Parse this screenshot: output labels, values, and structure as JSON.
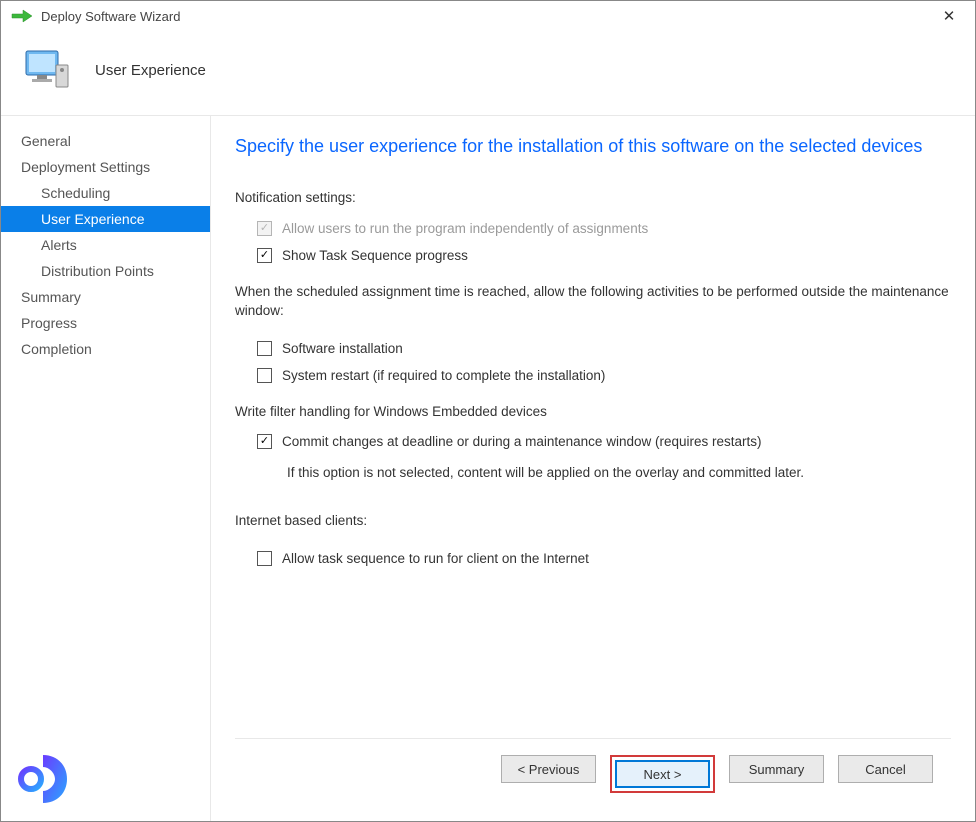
{
  "window": {
    "title": "Deploy Software Wizard"
  },
  "header": {
    "step": "User Experience"
  },
  "sidebar": {
    "items": [
      {
        "label": "General",
        "sub": false,
        "selected": false
      },
      {
        "label": "Deployment Settings",
        "sub": false,
        "selected": false
      },
      {
        "label": "Scheduling",
        "sub": true,
        "selected": false
      },
      {
        "label": "User Experience",
        "sub": true,
        "selected": true
      },
      {
        "label": "Alerts",
        "sub": true,
        "selected": false
      },
      {
        "label": "Distribution Points",
        "sub": true,
        "selected": false
      },
      {
        "label": "Summary",
        "sub": false,
        "selected": false
      },
      {
        "label": "Progress",
        "sub": false,
        "selected": false
      },
      {
        "label": "Completion",
        "sub": false,
        "selected": false
      }
    ]
  },
  "main": {
    "heading": "Specify the user experience for the installation of this software on the selected devices",
    "notification_label": "Notification settings:",
    "allow_independent": {
      "label": "Allow users to run the program independently of assignments",
      "checked": true,
      "disabled": true
    },
    "show_progress": {
      "label": "Show Task Sequence progress",
      "checked": true
    },
    "maint_window_text": "When the scheduled assignment time is reached, allow the following activities to be performed outside the maintenance window:",
    "software_install": {
      "label": "Software installation",
      "checked": false
    },
    "system_restart": {
      "label": "System restart (if required to complete the installation)",
      "checked": false
    },
    "write_filter_label": "Write filter handling for Windows Embedded devices",
    "commit_changes": {
      "label": "Commit changes at deadline or during a maintenance window (requires restarts)",
      "checked": true
    },
    "commit_note": "If this option is not selected, content will be applied on the overlay and committed later.",
    "internet_label": "Internet based clients:",
    "allow_internet": {
      "label": "Allow task sequence to run for client on the Internet",
      "checked": false
    }
  },
  "buttons": {
    "previous": "< Previous",
    "next": "Next >",
    "summary": "Summary",
    "cancel": "Cancel"
  }
}
